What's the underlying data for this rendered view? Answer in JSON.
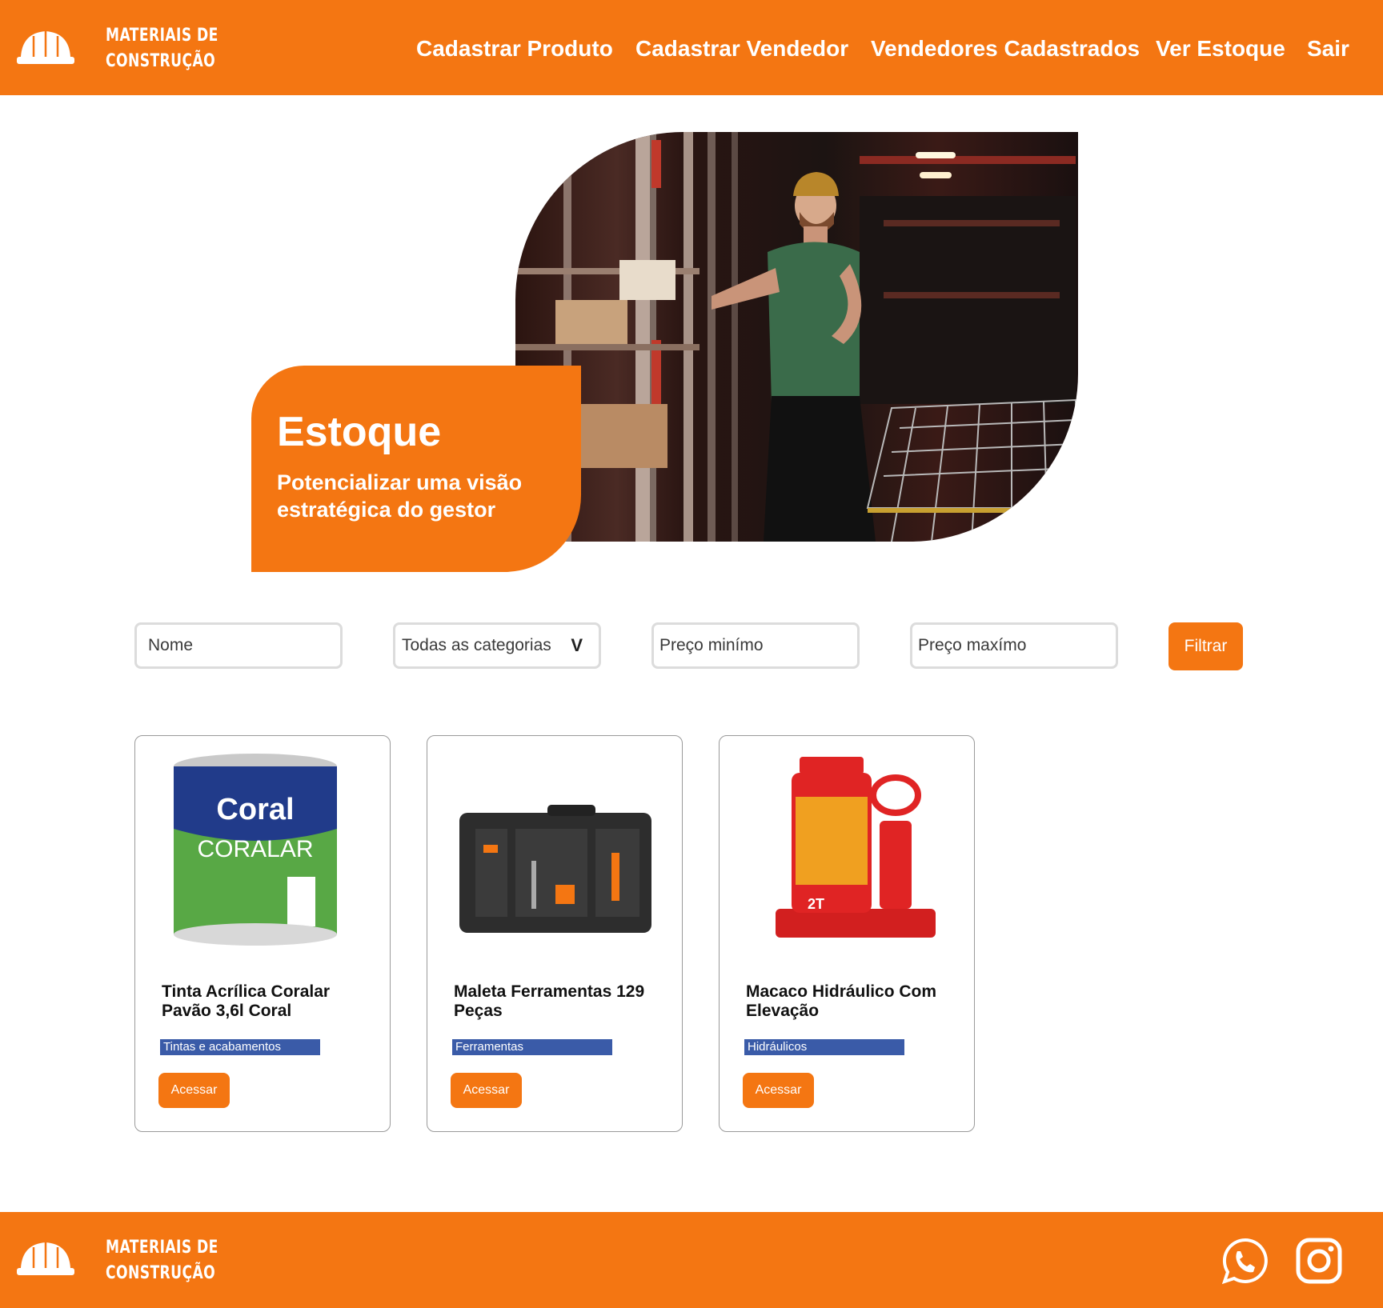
{
  "brand": {
    "line1": "MATERIAIS DE",
    "line2": "CONSTRUÇÃO"
  },
  "nav": [
    {
      "label": "Cadastrar Produto"
    },
    {
      "label": "Cadastrar Vendedor"
    },
    {
      "label": "Vendedores Cadastrados"
    },
    {
      "label": "Ver Estoque"
    },
    {
      "label": "Sair"
    }
  ],
  "hero": {
    "title": "Estoque",
    "subtitle": "Potencializar uma visão estratégica do gestor"
  },
  "filters": {
    "name_placeholder": "Nome",
    "category_selected": "Todas as categorias",
    "min_price_placeholder": "Preço minímo",
    "max_price_placeholder": "Preço maxímo",
    "filter_button": "Filtrar"
  },
  "products": [
    {
      "title": "Tinta Acrílica Coralar Pavão 3,6l Coral",
      "category": "Tintas e acabamentos",
      "button": "Acessar",
      "image_label": "Coral CORALAR"
    },
    {
      "title": "Maleta Ferramentas 129 Peças",
      "category": "Ferramentas",
      "button": "Acessar"
    },
    {
      "title": "Macaco Hidráulico Com Elevação",
      "category": "Hidráulicos",
      "button": "Acessar",
      "image_label": "2T"
    }
  ],
  "colors": {
    "accent": "#f47612",
    "category_badge": "#3a5ba8"
  }
}
